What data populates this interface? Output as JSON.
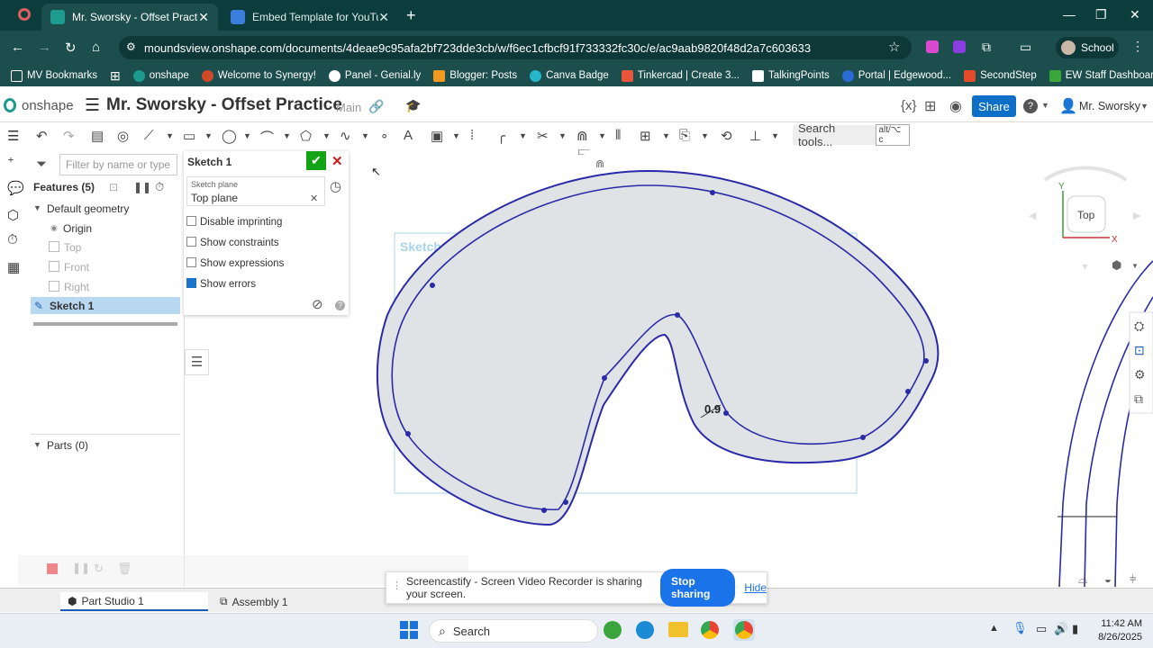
{
  "browser": {
    "tabs": [
      {
        "title": "Mr. Sworsky - Offset Practice | ",
        "active": true
      },
      {
        "title": "Embed Template for YouTube - ",
        "active": false
      }
    ],
    "url": "moundsview.onshape.com/documents/4deae9c95afa2bf723dde3cb/w/f6ec1cfbcf91f733332fc30c/e/ac9aab9820f48d2a7c603633",
    "profile": "School",
    "bookmarks": [
      "MV Bookmarks",
      "onshape",
      "Welcome to Synergy!",
      "Panel - Genial.ly",
      "Blogger: Posts",
      "Canva Badge",
      "Tinkercad | Create 3...",
      "TalkingPoints",
      "Portal | Edgewood...",
      "SecondStep",
      "EW Staff Dashboard"
    ]
  },
  "onshape": {
    "logo": "onshape",
    "doc_title": "Mr. Sworsky - Offset Practice",
    "branch": "Main",
    "share": "Share",
    "user": "Mr. Sworsky",
    "search_tools": "Search tools...",
    "search_shortcut": "alt/⌥ c"
  },
  "features": {
    "filter_placeholder": "Filter by name or type",
    "header": "Features (5)",
    "default_geometry": "Default geometry",
    "items": [
      "Origin",
      "Top",
      "Front",
      "Right"
    ],
    "sketch": "Sketch 1",
    "parts": "Parts (0)"
  },
  "sketch_dialog": {
    "title": "Sketch 1",
    "plane_label": "Sketch plane",
    "plane_value": "Top plane",
    "options": [
      {
        "label": "Disable imprinting",
        "checked": false
      },
      {
        "label": "Show constraints",
        "checked": false
      },
      {
        "label": "Show expressions",
        "checked": false
      },
      {
        "label": "Show errors",
        "checked": true
      }
    ]
  },
  "canvas": {
    "sketch_label": "Sketch 1",
    "dimension": "0.9",
    "view_cube": "Top",
    "axis_y": "Y",
    "axis_x": "X"
  },
  "bottom_tabs": [
    "Part Studio 1",
    "Assembly 1"
  ],
  "screencastify": {
    "message": "Screencastify - Screen Video Recorder is sharing your screen.",
    "stop": "Stop sharing",
    "hide": "Hide"
  },
  "taskbar": {
    "search": "Search",
    "time": "11:42 AM",
    "date": "8/26/2025"
  },
  "colors": {
    "sketch_line": "#2a2aa8",
    "sketch_fill": "#dfe3e6",
    "accent": "#0d6fc7",
    "chrome_dark": "#0b3d3c"
  }
}
